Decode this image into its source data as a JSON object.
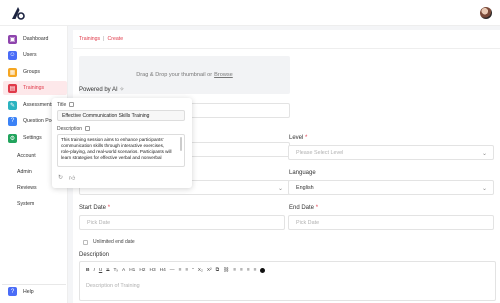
{
  "sidebar": {
    "items": [
      {
        "label": "Dashboard",
        "color": "#8e44ad",
        "icon": "dashboard-icon",
        "glyph": "▣"
      },
      {
        "label": "Users",
        "color": "#4a6cf7",
        "icon": "users-icon",
        "glyph": "☺"
      },
      {
        "label": "Groups",
        "color": "#f5a623",
        "icon": "groups-icon",
        "glyph": "▦"
      },
      {
        "label": "Trainings",
        "color": "#e03a4a",
        "icon": "trainings-icon",
        "glyph": "▤"
      },
      {
        "label": "Assessments",
        "color": "#2bb3c0",
        "icon": "assessments-icon",
        "glyph": "✎"
      },
      {
        "label": "Question Pool",
        "color": "#3b82f6",
        "icon": "question-pool-icon",
        "glyph": "?"
      },
      {
        "label": "Settings",
        "color": "#22a45d",
        "icon": "settings-icon",
        "glyph": "⚙"
      }
    ],
    "sub_items": [
      "Account",
      "Admin",
      "Reviews",
      "System"
    ],
    "help_label": "Help"
  },
  "breadcrumb": {
    "parent": "Trainings",
    "current": "Create"
  },
  "upload": {
    "text": "Drag & Drop your thumbnail or",
    "link": "Browse"
  },
  "powered_by": "Powered by AI",
  "form": {
    "level_label": "Level",
    "level_placeholder": "Please Select Level",
    "language_label": "Language",
    "language_value": "English",
    "start_date_label": "Start Date",
    "start_date_placeholder": "Pick Date",
    "end_date_label": "End Date",
    "end_date_placeholder": "Pick Date",
    "unlimited_label": "Unlimited end date",
    "description_label": "Description",
    "description_placeholder": "Description of Training",
    "toolbar": [
      "B",
      "I",
      "U",
      "S",
      "Tₓ",
      "A",
      "H1",
      "H2",
      "H3",
      "H4",
      "—",
      "≡",
      "≡",
      "”",
      "X₂",
      "X²",
      "⧉",
      "⛓",
      "≡",
      "≡",
      "≡",
      "≡"
    ]
  },
  "ai_popover": {
    "title_label": "Title",
    "title_value": "Effective Communication Skills Training",
    "description_label": "Description",
    "description_value": "This training session aims to enhance participants' communication skills through interactive exercises, role-playing, and real-world scenarios. Participants will learn strategies for effective verbal and nonverbal"
  }
}
